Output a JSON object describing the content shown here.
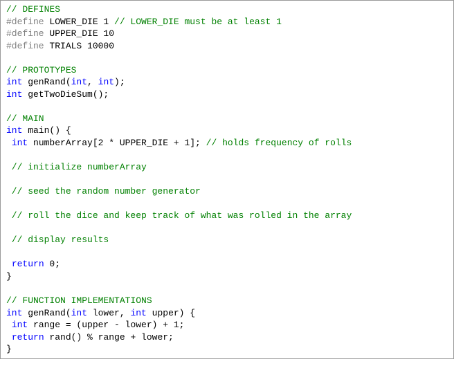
{
  "code": {
    "l01a": "// DEFINES",
    "l02a": "#define",
    "l02b": " LOWER_DIE 1 ",
    "l02c": "// LOWER_DIE must be at least 1",
    "l03a": "#define",
    "l03b": " UPPER_DIE 10",
    "l04a": "#define",
    "l04b": " TRIALS 10000",
    "l06a": "// PROTOTYPES",
    "l07a": "int",
    "l07b": " genRand(",
    "l07c": "int",
    "l07d": ", ",
    "l07e": "int",
    "l07f": ");",
    "l08a": "int",
    "l08b": " getTwoDieSum();",
    "l10a": "// MAIN",
    "l11a": "int",
    "l11b": " main() {",
    "l12a": " ",
    "l12b": "int",
    "l12c": " numberArray[2 * UPPER_DIE + 1]; ",
    "l12d": "// holds frequency of rolls",
    "l14a": " // initialize numberArray",
    "l16a": " // seed the random number generator",
    "l18a": " // roll the dice and keep track of what was rolled in the array",
    "l20a": " // display results",
    "l22a": " ",
    "l22b": "return",
    "l22c": " 0;",
    "l23a": "}",
    "l25a": "// FUNCTION IMPLEMENTATIONS",
    "l26a": "int",
    "l26b": " genRand(",
    "l26c": "int",
    "l26d": " lower, ",
    "l26e": "int",
    "l26f": " upper) {",
    "l27a": " ",
    "l27b": "int",
    "l27c": " range = (upper - lower) + 1;",
    "l28a": " ",
    "l28b": "return",
    "l28c": " rand() % range + lower;",
    "l29a": "}"
  }
}
